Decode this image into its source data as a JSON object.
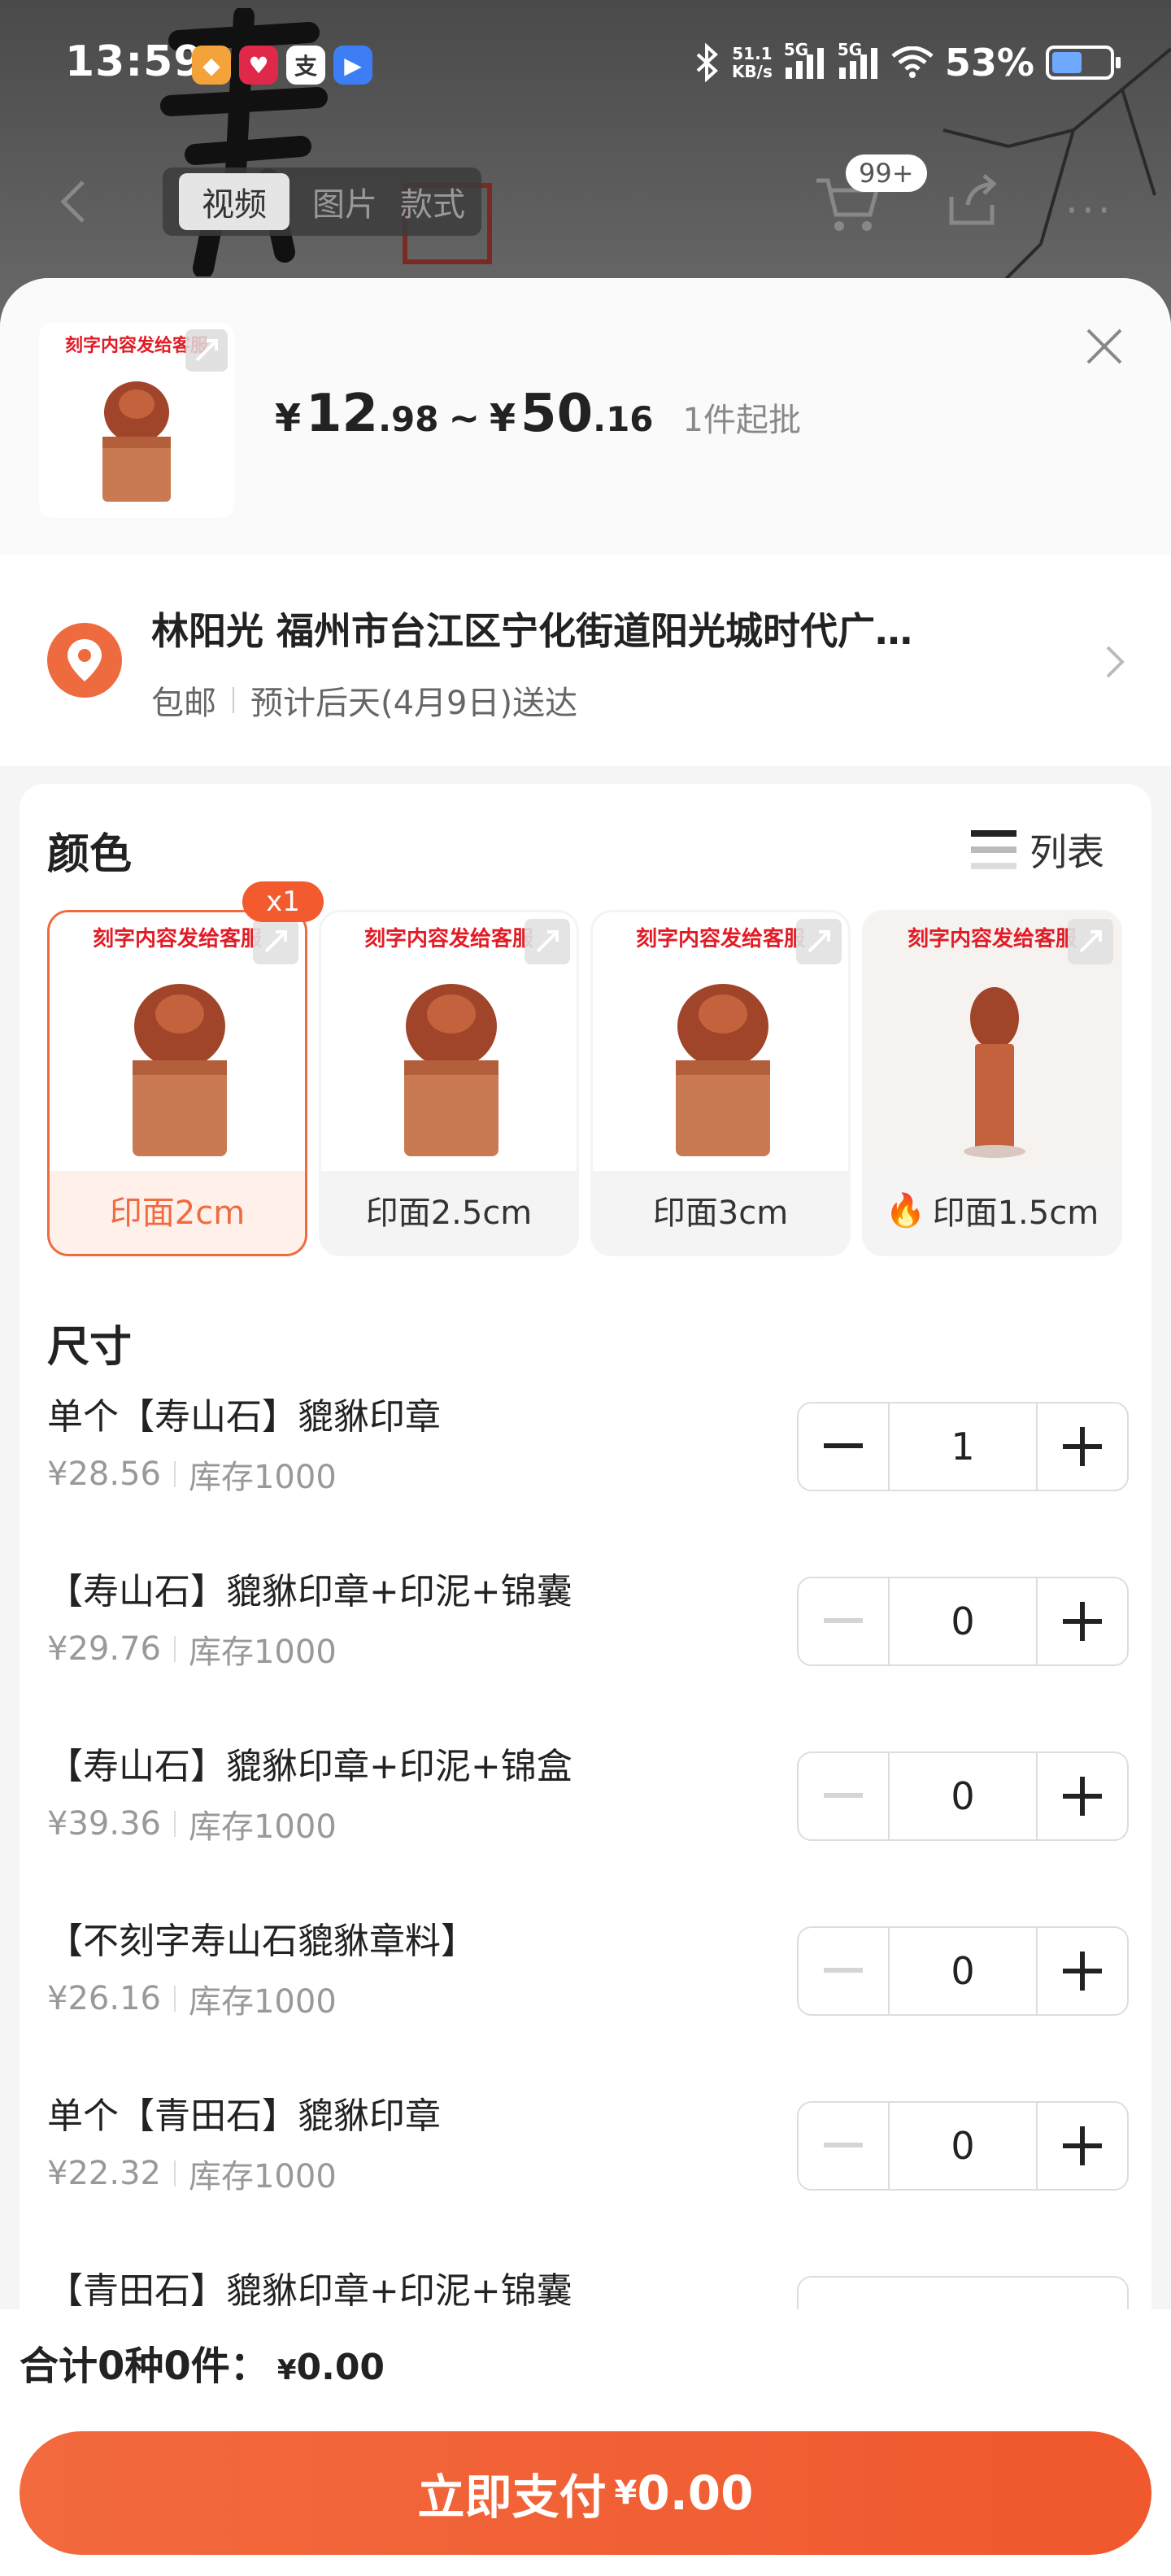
{
  "status": {
    "time": "13:59",
    "speed_value": "51.1",
    "speed_unit": "KB/s",
    "net1": "5G",
    "net2": "5G",
    "battery": "53%",
    "battery_level": 0.53
  },
  "background": {
    "tabs": [
      "视频",
      "图片",
      "款式"
    ],
    "active_tab": "视频",
    "cart_badge": "99+"
  },
  "header": {
    "thumb_banner": "刻字内容发给客服",
    "price_low_int": "12",
    "price_low_dec": ".98",
    "price_high_int": "50",
    "price_high_dec": ".16",
    "currency": "¥",
    "sep": "~",
    "moq": "1件起批"
  },
  "address": {
    "title": "林阳光 福州市台江区宁化街道阳光城时代广…",
    "shipping": "包邮",
    "eta": "预计后天(4月9日)送达"
  },
  "color": {
    "title": "颜色",
    "list_label": "列表",
    "banner": "刻字内容发给客服",
    "selected_badge": "x1",
    "options": [
      {
        "label": "印面2cm"
      },
      {
        "label": "印面2.5cm"
      },
      {
        "label": "印面3cm"
      },
      {
        "label": "印面1.5cm"
      }
    ]
  },
  "size": {
    "title": "尺寸",
    "rows": [
      {
        "name": "单个【寿山石】貔貅印章",
        "price": "¥28.56",
        "stock": "库存1000",
        "qty": "1"
      },
      {
        "name": "【寿山石】貔貅印章+印泥+锦囊",
        "price": "¥29.76",
        "stock": "库存1000",
        "qty": "0"
      },
      {
        "name": "【寿山石】貔貅印章+印泥+锦盒",
        "price": "¥39.36",
        "stock": "库存1000",
        "qty": "0"
      },
      {
        "name": "【不刻字寿山石貔貅章料】",
        "price": "¥26.16",
        "stock": "库存1000",
        "qty": "0"
      },
      {
        "name": "单个【青田石】貔貅印章",
        "price": "¥22.32",
        "stock": "库存1000",
        "qty": "0"
      },
      {
        "name": "【青田石】貔貅印章+印泥+锦囊",
        "price": "",
        "stock": "",
        "qty": ""
      }
    ]
  },
  "footer": {
    "total_label": "合计0种0件：",
    "total_currency": "¥",
    "total_value": "0.00",
    "pay_label": "立即支付",
    "pay_currency": "¥",
    "pay_value": "0.00"
  },
  "colors": {
    "accent": "#f06a40",
    "banner_red": "#e21c26"
  }
}
